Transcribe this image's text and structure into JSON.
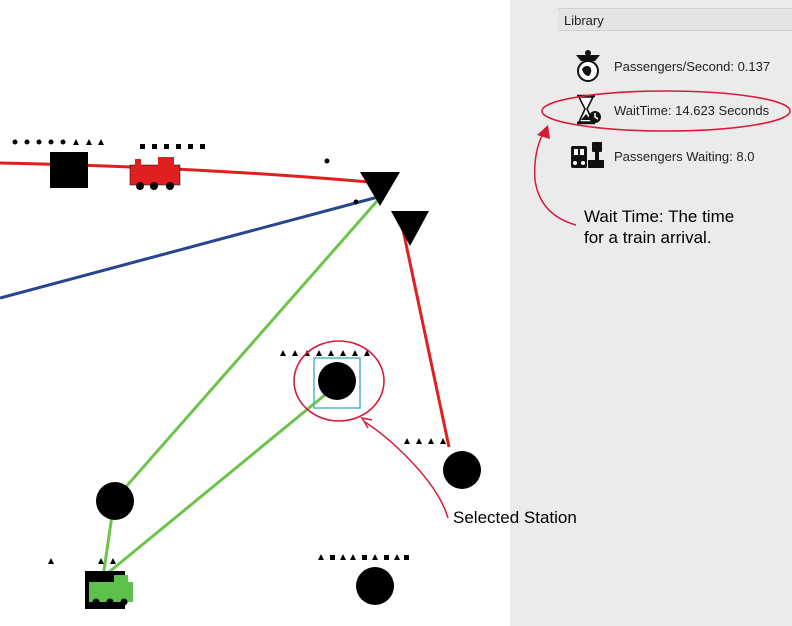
{
  "library": {
    "title": "Library",
    "stats": [
      {
        "icon": "passenger-globe-icon",
        "label": "Passengers/Second: 0.137"
      },
      {
        "icon": "hourglass-icon",
        "label": "WaitTime: 14.623 Seconds"
      },
      {
        "icon": "waiting-passengers-icon",
        "label": "Passengers Waiting: 8.0"
      }
    ]
  },
  "annotations": {
    "wait_time_line1": "Wait Time: The time",
    "wait_time_line2": "for a train arrival.",
    "selected_station": "Selected Station"
  },
  "colors": {
    "red_line": "#e02020",
    "green_line": "#6ec44a",
    "blue_line": "#27458f",
    "annotation": "#d81b3a",
    "selection": "#4fb6c4"
  }
}
